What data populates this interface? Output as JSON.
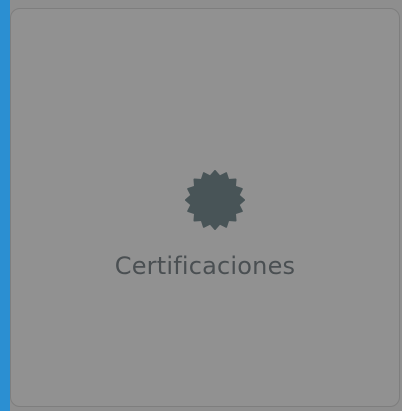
{
  "card": {
    "label": "Certificaciones",
    "icon": "certificate-seal-icon"
  },
  "colors": {
    "accent": "#2b8fd2",
    "overlay_background": "#8e8e8e",
    "card_background": "#919191",
    "icon": "#485457",
    "text": "#4a4f52"
  }
}
